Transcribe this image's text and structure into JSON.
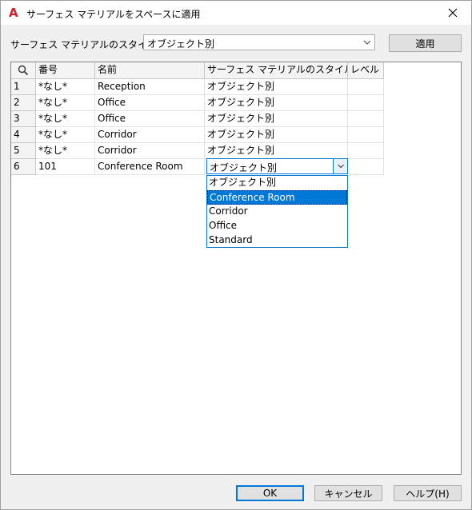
{
  "window": {
    "title": "サーフェス マテリアルをスペースに適用",
    "app_icon_glyph": "A",
    "accent_color": "#0078d7"
  },
  "style_row": {
    "label": "サーフェス マテリアルのスタイル:",
    "selected": "オブジェクト別",
    "apply_label": "適用"
  },
  "table": {
    "columns": [
      "番号",
      "名前",
      "サーフェス マテリアルのスタイル",
      "レベル"
    ],
    "rows": [
      {
        "index": "1",
        "number": "*なし*",
        "name": "Reception",
        "style": "オブジェクト別",
        "level": ""
      },
      {
        "index": "2",
        "number": "*なし*",
        "name": "Office",
        "style": "オブジェクト別",
        "level": ""
      },
      {
        "index": "3",
        "number": "*なし*",
        "name": "Office",
        "style": "オブジェクト別",
        "level": ""
      },
      {
        "index": "4",
        "number": "*なし*",
        "name": "Corridor",
        "style": "オブジェクト別",
        "level": ""
      },
      {
        "index": "5",
        "number": "*なし*",
        "name": "Corridor",
        "style": "オブジェクト別",
        "level": ""
      },
      {
        "index": "6",
        "number": "101",
        "name": "Conference Room",
        "style": "オブジェクト別",
        "level": ""
      }
    ],
    "active_dropdown": {
      "value": "オブジェクト別",
      "options": [
        "オブジェクト別",
        "Conference Room",
        "Corridor",
        "Office",
        "Standard"
      ],
      "highlighted": "Conference Room"
    }
  },
  "footer": {
    "ok_label": "OK",
    "cancel_label": "キャンセル",
    "help_label": "ヘルプ(H)"
  }
}
